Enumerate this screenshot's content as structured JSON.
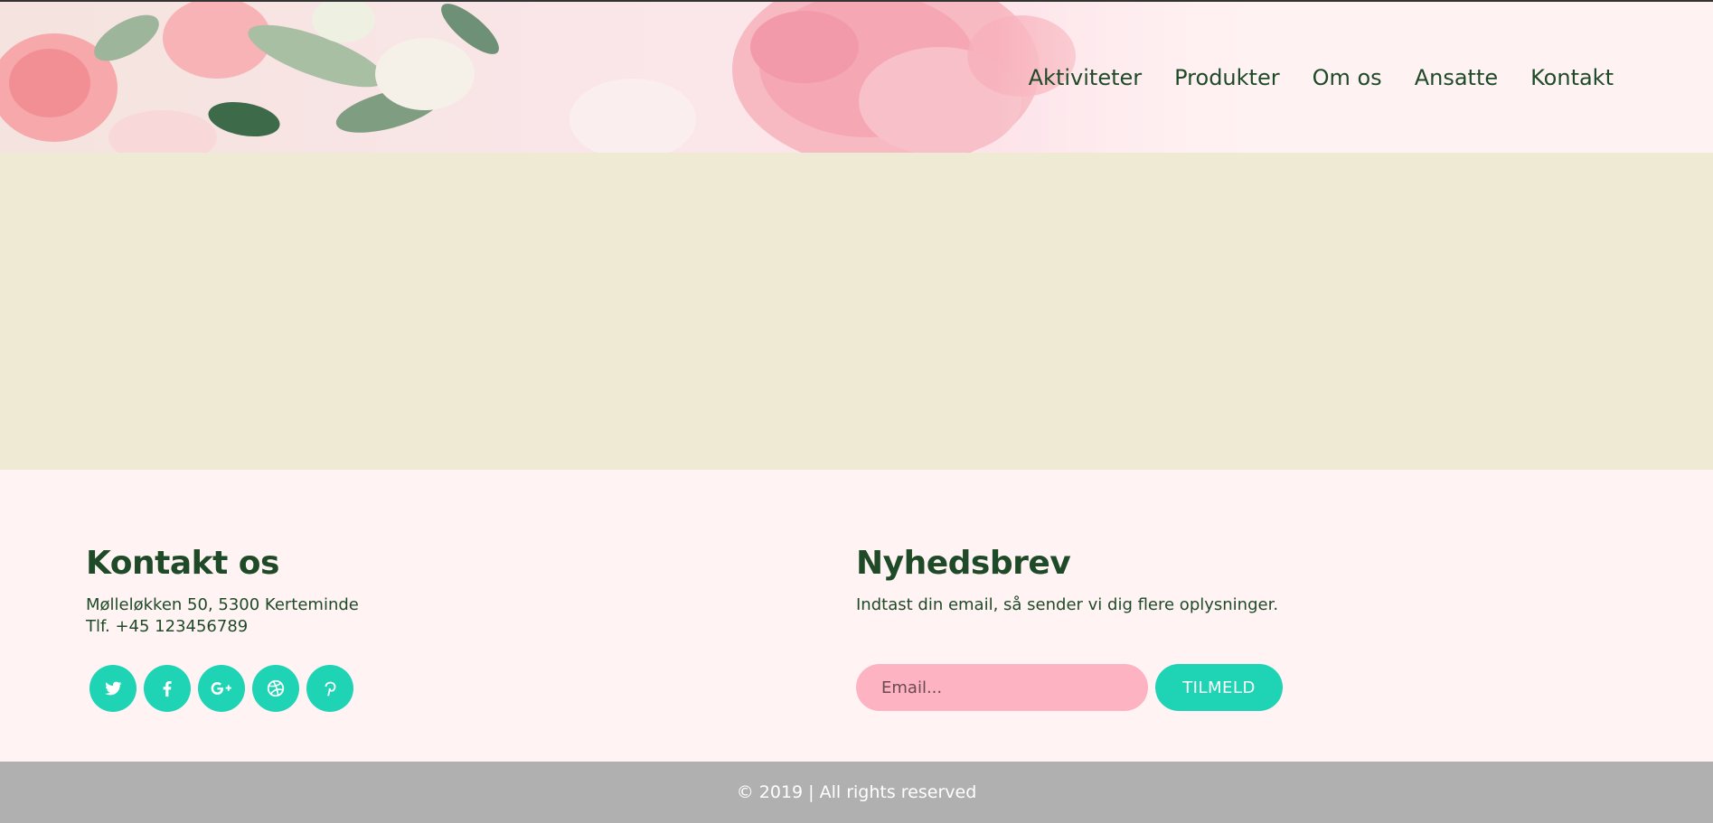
{
  "nav": {
    "items": [
      {
        "label": "Aktiviteter"
      },
      {
        "label": "Produkter"
      },
      {
        "label": "Om os"
      },
      {
        "label": "Ansatte"
      },
      {
        "label": "Kontakt"
      }
    ]
  },
  "contact": {
    "title": "Kontakt os",
    "address": "Mølleløkken 50, 5300 Kerteminde",
    "phone": "Tlf. +45 123456789",
    "social": [
      {
        "icon": "twitter-icon",
        "glyph": "t"
      },
      {
        "icon": "facebook-icon",
        "glyph": "f"
      },
      {
        "icon": "google-plus-icon",
        "glyph": "g+"
      },
      {
        "icon": "dribbble-icon",
        "glyph": "◎"
      },
      {
        "icon": "pinterest-icon",
        "glyph": "p"
      }
    ]
  },
  "newsletter": {
    "title": "Nyhedsbrev",
    "description": "Indtast din email, så sender vi dig flere oplysninger.",
    "email_placeholder": "Email...",
    "button_label": "TILMELD"
  },
  "footer": {
    "copyright": "© 2019 | All rights reserved"
  },
  "colors": {
    "accent": "#1fd3b5",
    "text_green": "#1f4a28",
    "band": "#efead3",
    "input_pink": "#fdb3c1",
    "bottom_bar": "#b0b0b0"
  }
}
